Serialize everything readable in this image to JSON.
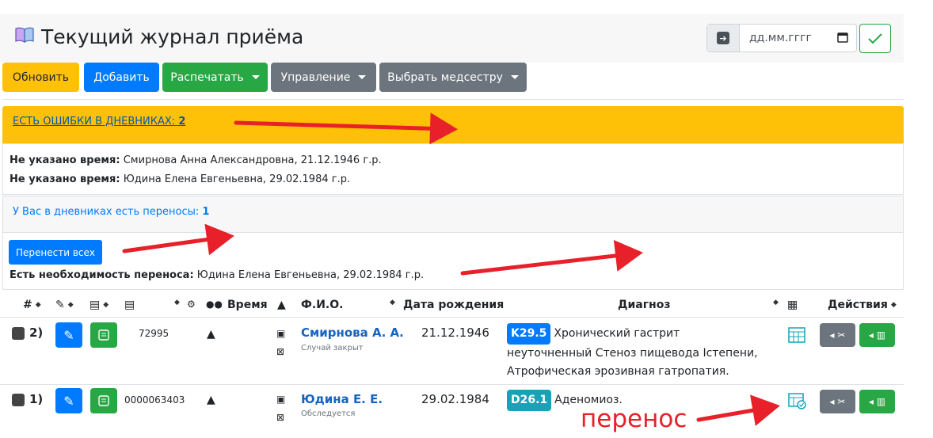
{
  "header": {
    "title": "Текущий журнал приёма",
    "date_placeholder": "дд.мм.гггг"
  },
  "toolbar": {
    "refresh": "Обновить",
    "add": "Добавить",
    "print": "Распечатать",
    "manage": "Управление",
    "nurse": "Выбрать медсестру"
  },
  "errors": {
    "link_text": "ЕСТЬ ОШИБКИ В ДНЕВНИКАХ:",
    "count": "2",
    "items": [
      {
        "label": "Не указано время:",
        "text": "Смирнова Анна Александровна, 21.12.1946 г.р."
      },
      {
        "label": "Не указано время:",
        "text": "Юдина Елена Евгеньевна, 29.02.1984 г.р."
      }
    ]
  },
  "transfers": {
    "link_text": "У Вас в дневниках есть переносы:",
    "count": "1",
    "move_all": "Перенести всех",
    "label": "Есть необходимость переноса:",
    "text": "Юдина Елена Евгеньевна, 29.02.1984 г.р."
  },
  "table": {
    "col_num": "#",
    "col_time": "Время",
    "col_fio": "Ф.И.О.",
    "col_dob": "Дата рождения",
    "col_diag": "Диагноз",
    "col_actions": "Действия",
    "rows": [
      {
        "index": "2)",
        "card": "72995",
        "name": "Смирнова А. А.",
        "status": "Случай закрыт",
        "dob": "21.12.1946",
        "code": "K29.5",
        "code_color": "#007bff",
        "diagnosis": "Хронический гастрит неуточненный Стеноз пищевода Iстепени, Атрофическая эрозивная гатропатия."
      },
      {
        "index": "1)",
        "card": "0000063403",
        "name": "Юдина Е. Е.",
        "status": "Обследуется",
        "dob": "29.02.1984",
        "code": "D26.1",
        "code_color": "#17a2b8",
        "diagnosis": "Аденомиоз."
      }
    ]
  },
  "annotation": {
    "text": "перенос"
  },
  "colors": {
    "yellow": "#ffc107",
    "blue": "#007bff",
    "green": "#28a745",
    "gray": "#6c757d",
    "arrow": "#e8202a"
  }
}
